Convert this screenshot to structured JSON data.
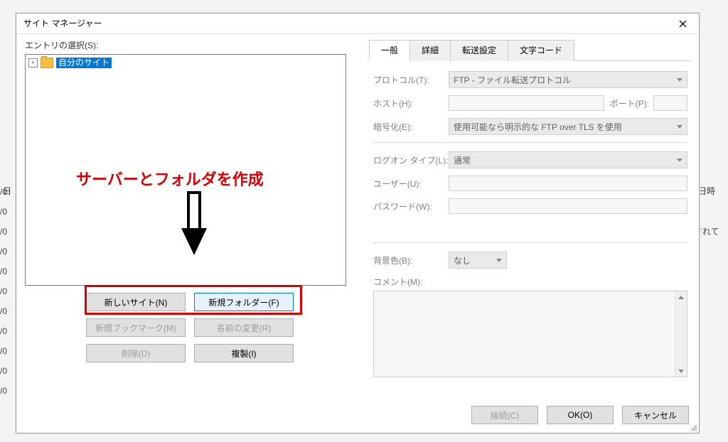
{
  "window_title": "サイト マネージャー",
  "entry_label": "エントリの選択(S):",
  "tree": {
    "root_label": "自分のサイト"
  },
  "buttons": {
    "new_site": "新しいサイト(N)",
    "new_folder": "新規フォルダー(F)",
    "new_bookmark": "新規ブックマーク(M)",
    "rename": "名前の変更(R)",
    "delete": "削除(D)",
    "duplicate": "複製(I)"
  },
  "annotation": "サーバーとフォルダを作成",
  "tabs": {
    "general": "一般",
    "advanced": "詳細",
    "transfer": "転送設定",
    "charset": "文字コード"
  },
  "form": {
    "protocol_label": "プロトコル(T):",
    "protocol_value": "FTP - ファイル転送プロトコル",
    "host_label": "ホスト(H):",
    "port_label": "ポート(P):",
    "encryption_label": "暗号化(E):",
    "encryption_value": "使用可能なら明示的な FTP over TLS を使用",
    "logon_type_label": "ログオン タイプ(L):",
    "logon_type_value": "通常",
    "user_label": "ユーザー(U):",
    "password_label": "パスワード(W):",
    "bgcolor_label": "背景色(B):",
    "bgcolor_value": "なし",
    "comment_label": "コメント(M):"
  },
  "footer": {
    "connect": "接続(C)",
    "ok": "OK(O)",
    "cancel": "キャンセル"
  },
  "background": {
    "left_header": "日",
    "right_header": "日時",
    "right_line": "続されて",
    "row_fragment": "/0"
  }
}
